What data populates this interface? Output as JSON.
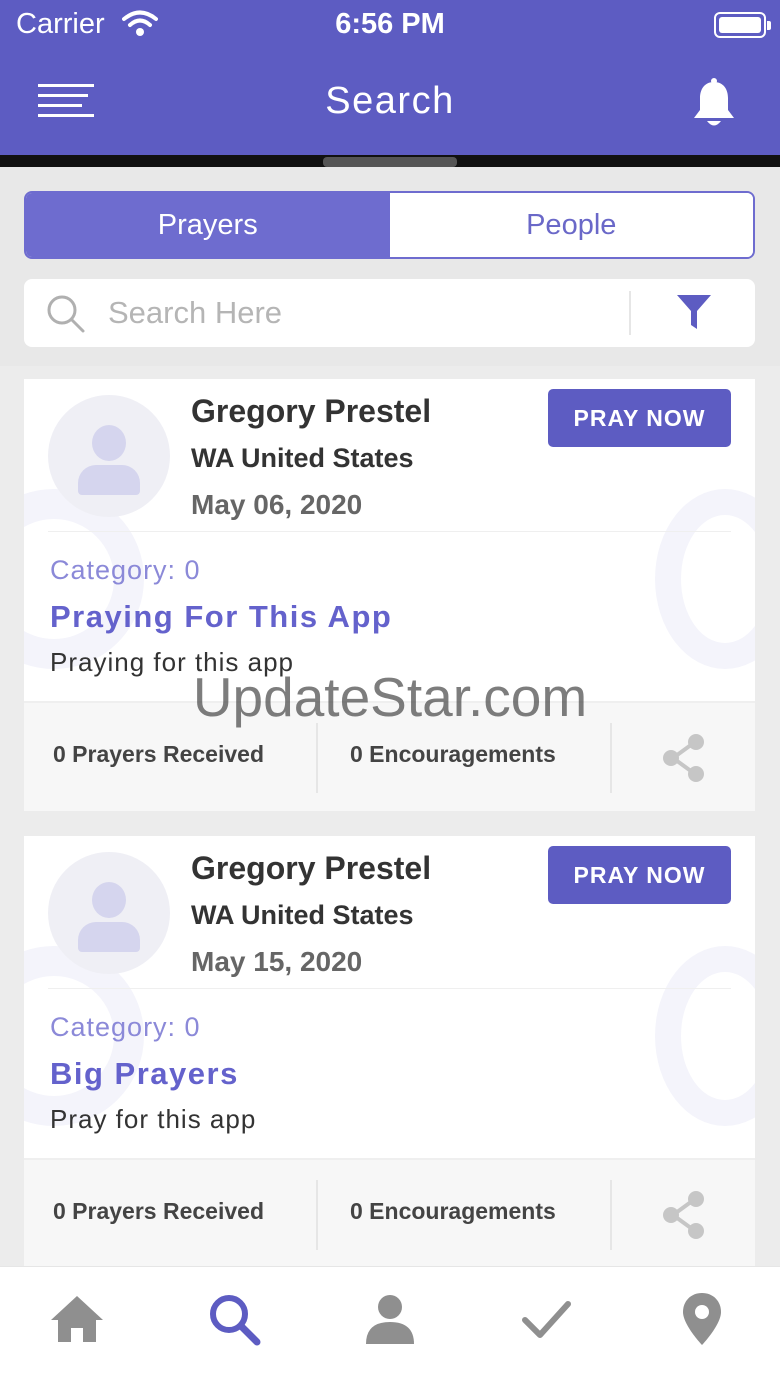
{
  "status_bar": {
    "carrier": "Carrier",
    "time": "6:56 PM",
    "icons": [
      "wifi-icon",
      "battery-icon"
    ]
  },
  "nav": {
    "title": "Search",
    "left_icon": "menu-icon",
    "right_icon": "bell-icon"
  },
  "tabs": [
    {
      "label": "Prayers",
      "active": true
    },
    {
      "label": "People",
      "active": false
    }
  ],
  "search": {
    "placeholder": "Search Here",
    "value": "",
    "icons": [
      "search-icon",
      "filter-icon"
    ]
  },
  "prayers": [
    {
      "name": "Gregory Prestel",
      "location": "WA United States",
      "date": "May 06, 2020",
      "button": "PRAY NOW",
      "category": "Category: 0",
      "title": "Praying For This App",
      "text": "Praying for this app",
      "prayers_received": "0 Prayers Received",
      "encouragements": "0 Encouragements"
    },
    {
      "name": "Gregory Prestel",
      "location": "WA United States",
      "date": "May 15, 2020",
      "button": "PRAY NOW",
      "category": "Category: 0",
      "title": "Big Prayers",
      "text": "Pray for this app",
      "prayers_received": "0 Prayers Received",
      "encouragements": "0 Encouragements"
    }
  ],
  "watermark": "UpdateStar.com",
  "tab_bar": {
    "items": [
      "home-icon",
      "search-icon",
      "profile-icon",
      "check-icon",
      "location-pin-icon"
    ],
    "active_index": 1
  },
  "colors": {
    "primary": "#5d5cc2",
    "tab_active": "#6e6ccf",
    "accent_text": "#6462cc",
    "icon_inactive": "#8f8f8f"
  }
}
